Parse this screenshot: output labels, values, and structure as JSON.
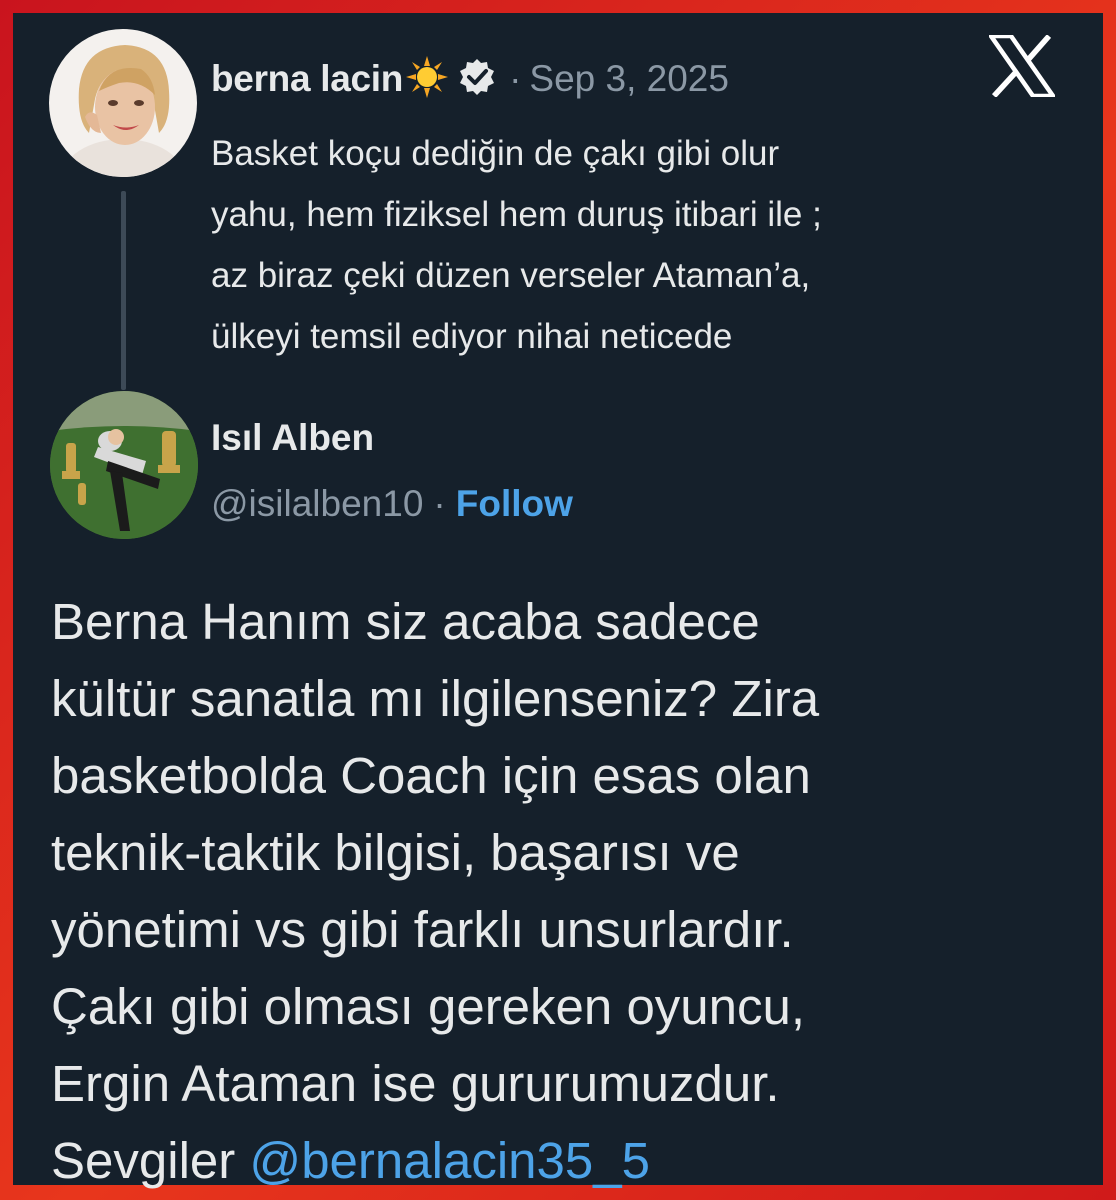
{
  "tweet": {
    "author_name": "berna lacin",
    "author_emoji": "sun-emoji",
    "verified": true,
    "separator": "·",
    "date": "Sep 3, 2025",
    "text": "Basket koçu dediğin de çakı gibi olur\nyahu, hem fiziksel hem duruş itibari ile ;\naz biraz çeki düzen verseler Ataman’a,\nülkeyi temsil ediyor nihai neticede"
  },
  "reply": {
    "author_name": "Isıl Alben",
    "handle": "@isilalben10",
    "separator": "·",
    "follow_label": "Follow",
    "text_before_mention": "Berna Hanım siz acaba sadece\nkültür sanatla mı ilgilenseniz? Zira\nbasketbolda Coach için esas olan\nteknik-taktik bilgisi, başarısı ve\nyönetimi vs gibi farklı unsurlardır.\nÇakı gibi olması gereken oyuncu,\nErgin Ataman ise gururumuzdur.\nSevgiler ",
    "mention": "@bernalacin35_5"
  },
  "platform_logo": "x-logo",
  "colors": {
    "background": "#15202b",
    "frame": "#e0291c",
    "text": "#e7e9ea",
    "muted": "#8b98a5",
    "link": "#4da3e8"
  }
}
